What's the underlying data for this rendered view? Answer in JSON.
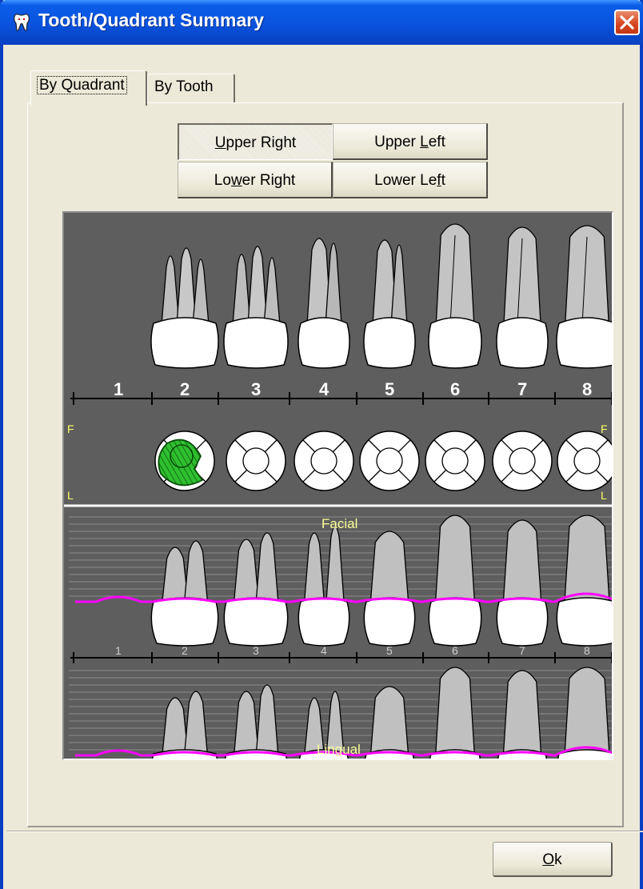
{
  "window": {
    "title": "Tooth/Quadrant Summary",
    "icon": "tooth-app-icon"
  },
  "tabs": [
    {
      "label": "By Quadrant",
      "active": true
    },
    {
      "label": "By Tooth",
      "active": false
    }
  ],
  "quadrant_buttons": {
    "upper_right": {
      "pre": "",
      "key": "U",
      "post": "pper Right",
      "selected": true
    },
    "upper_left": {
      "pre": "Upper ",
      "key": "L",
      "post": "eft",
      "selected": false
    },
    "lower_right": {
      "pre": "Lo",
      "key": "w",
      "post": "er Right",
      "selected": false
    },
    "lower_left": {
      "pre": "Lower Le",
      "key": "f",
      "post": "t",
      "selected": false
    }
  },
  "chart": {
    "tooth_numbers": [
      "1",
      "2",
      "3",
      "4",
      "5",
      "6",
      "7",
      "8"
    ],
    "side_labels": {
      "top_left": "F",
      "bottom_left": "L",
      "top_right": "F",
      "bottom_right": "L"
    },
    "facial_label": "Facial",
    "lingual_label": "Lingual",
    "filled_tooth": "2",
    "colors": {
      "background": "#5e5e5e",
      "gumline": "#ff00ff",
      "restoration": "#22aa22",
      "label_yellow": "#ffff66"
    }
  },
  "footer": {
    "ok": {
      "key": "O",
      "post": "k"
    }
  }
}
